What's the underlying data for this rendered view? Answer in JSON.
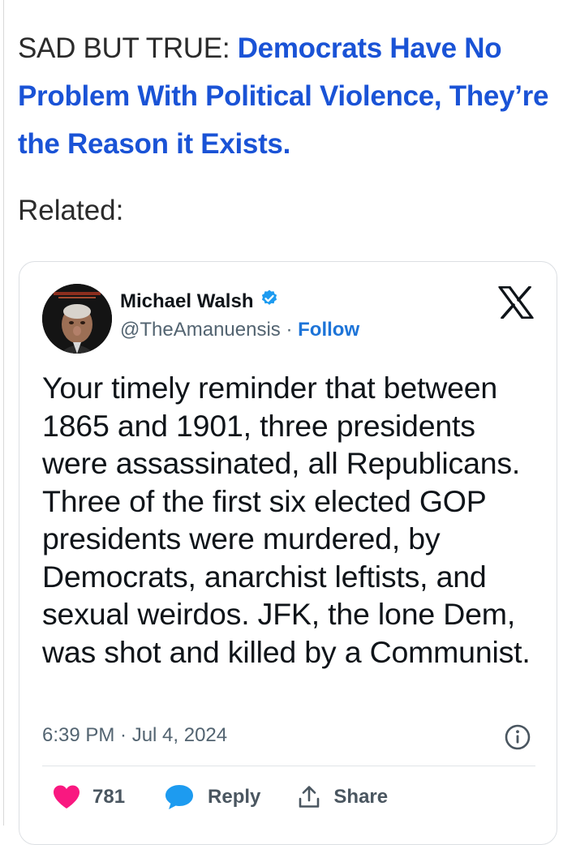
{
  "headline": {
    "prefix": "SAD BUT TRUE: ",
    "link_text": "Democrats Have No Problem With Political Violence, They’re the Reason it Exists."
  },
  "related_label": "Related:",
  "tweet": {
    "author_name": "Michael Walsh",
    "verified": true,
    "handle": "@TheAmanuensis",
    "separator": "·",
    "follow_label": "Follow",
    "platform_icon": "x-logo-icon",
    "text": "Your timely reminder that between 1865 and 1901, three presidents were assassinated, all Republicans. Three of the first six elected GOP presidents were murdered, by Democrats, anarchist leftists, and sexual weirdos. JFK, the lone Dem, was shot and killed by a Communist.",
    "timestamp": "6:39 PM · Jul 4, 2024",
    "like_count": "781",
    "reply_label": "Reply",
    "share_label": "Share"
  },
  "colors": {
    "link_blue": "#1a53d6",
    "follow_blue": "#1d74d8",
    "verified_blue": "#1d9bf0",
    "heart_pink": "#f91880",
    "reply_blue": "#1d9bf0"
  }
}
